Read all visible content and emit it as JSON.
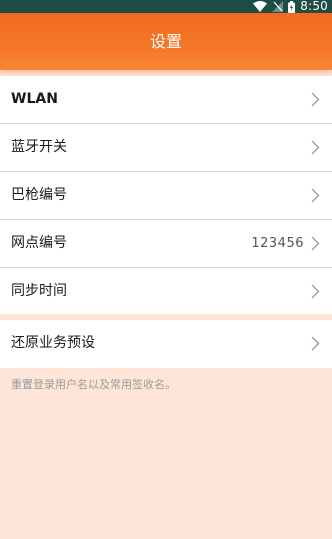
{
  "status_bar": {
    "time": "8:50",
    "icons": [
      "wifi-icon",
      "signal-icon",
      "battery-icon"
    ]
  },
  "header": {
    "title": "设置"
  },
  "settings": {
    "items": [
      {
        "label": "WLAN",
        "value": ""
      },
      {
        "label": "蓝牙开关",
        "value": ""
      },
      {
        "label": "巴枪编号",
        "value": ""
      },
      {
        "label": "网点编号",
        "value": "123456"
      },
      {
        "label": "同步时间",
        "value": ""
      }
    ],
    "reset": {
      "label": "还原业务预设",
      "hint": "重置登录用户名以及常用签收名。"
    }
  },
  "colors": {
    "status_bar": "#1d4d45",
    "header": "#f47727",
    "page_background": "#fde6d9",
    "divider": "#d9d9d9"
  }
}
